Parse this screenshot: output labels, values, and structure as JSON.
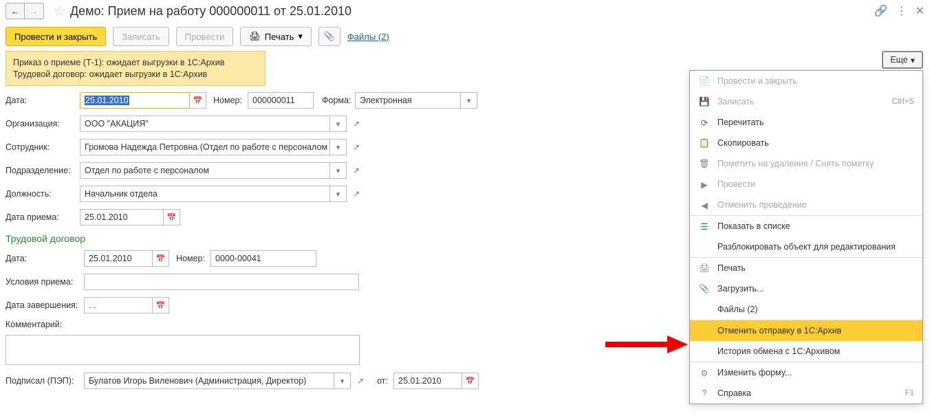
{
  "header": {
    "title": "Демо: Прием на работу 000000011 от 25.01.2010"
  },
  "toolbar": {
    "post_and_close": "Провести и закрыть",
    "save": "Записать",
    "post": "Провести",
    "print": "Печать",
    "files_link": "Файлы (2)"
  },
  "status": {
    "line1": "Приказ о приеме (Т-1): ожидает выгрузки в 1С:Архив",
    "line2": "Трудовой договор: ожидает выгрузки в 1С:Архив"
  },
  "form": {
    "date_label": "Дата:",
    "date_value": "25.01.2010",
    "number_label": "Номер:",
    "number_value": "000000011",
    "form_type_label": "Форма:",
    "form_type_value": "Электронная",
    "org_label": "Организация:",
    "org_value": "ООО \"АКАЦИЯ\"",
    "employee_label": "Сотрудник:",
    "employee_value": "Громова Надежда Петровна (Отдел по работе с персоналом",
    "dept_label": "Подразделение:",
    "dept_value": "Отдел по работе с персоналом",
    "position_label": "Должность:",
    "position_value": "Начальник отдела",
    "hire_date_label": "Дата приема:",
    "hire_date_value": "25.01.2010"
  },
  "contract": {
    "section": "Трудовой договор",
    "date_label": "Дата:",
    "date_value": "25.01.2010",
    "number_label": "Номер:",
    "number_value": "0000-00041",
    "conditions_label": "Условия приема:",
    "end_date_label": "Дата завершения:",
    "end_date_value": ".  .",
    "comment_label": "Комментарий:",
    "signed_label": "Подписал (ПЭП):",
    "signed_value": "Булатов Игорь Виленович (Администрация, Директор)",
    "from_label": "от:",
    "from_value": "25.01.2010"
  },
  "more_btn": "Еще",
  "menu": {
    "post_and_close": "Провести и закрыть",
    "save": "Записать",
    "save_sc": "Ctrl+S",
    "reread": "Перечитать",
    "copy": "Скопировать",
    "mark_delete": "Пометить на удаление / Снять пометку",
    "post": "Провести",
    "unpost": "Отменить проведение",
    "show_list": "Показать в списке",
    "unlock": "Разблокировать объект для редактирования",
    "print": "Печать",
    "upload": "Загрузить...",
    "files": "Файлы (2)",
    "cancel_send": "Отменить отправку в 1С:Архив",
    "history": "История обмена с 1С:Архивом",
    "edit_form": "Изменить форму...",
    "help": "Справка",
    "help_sc": "F1"
  }
}
